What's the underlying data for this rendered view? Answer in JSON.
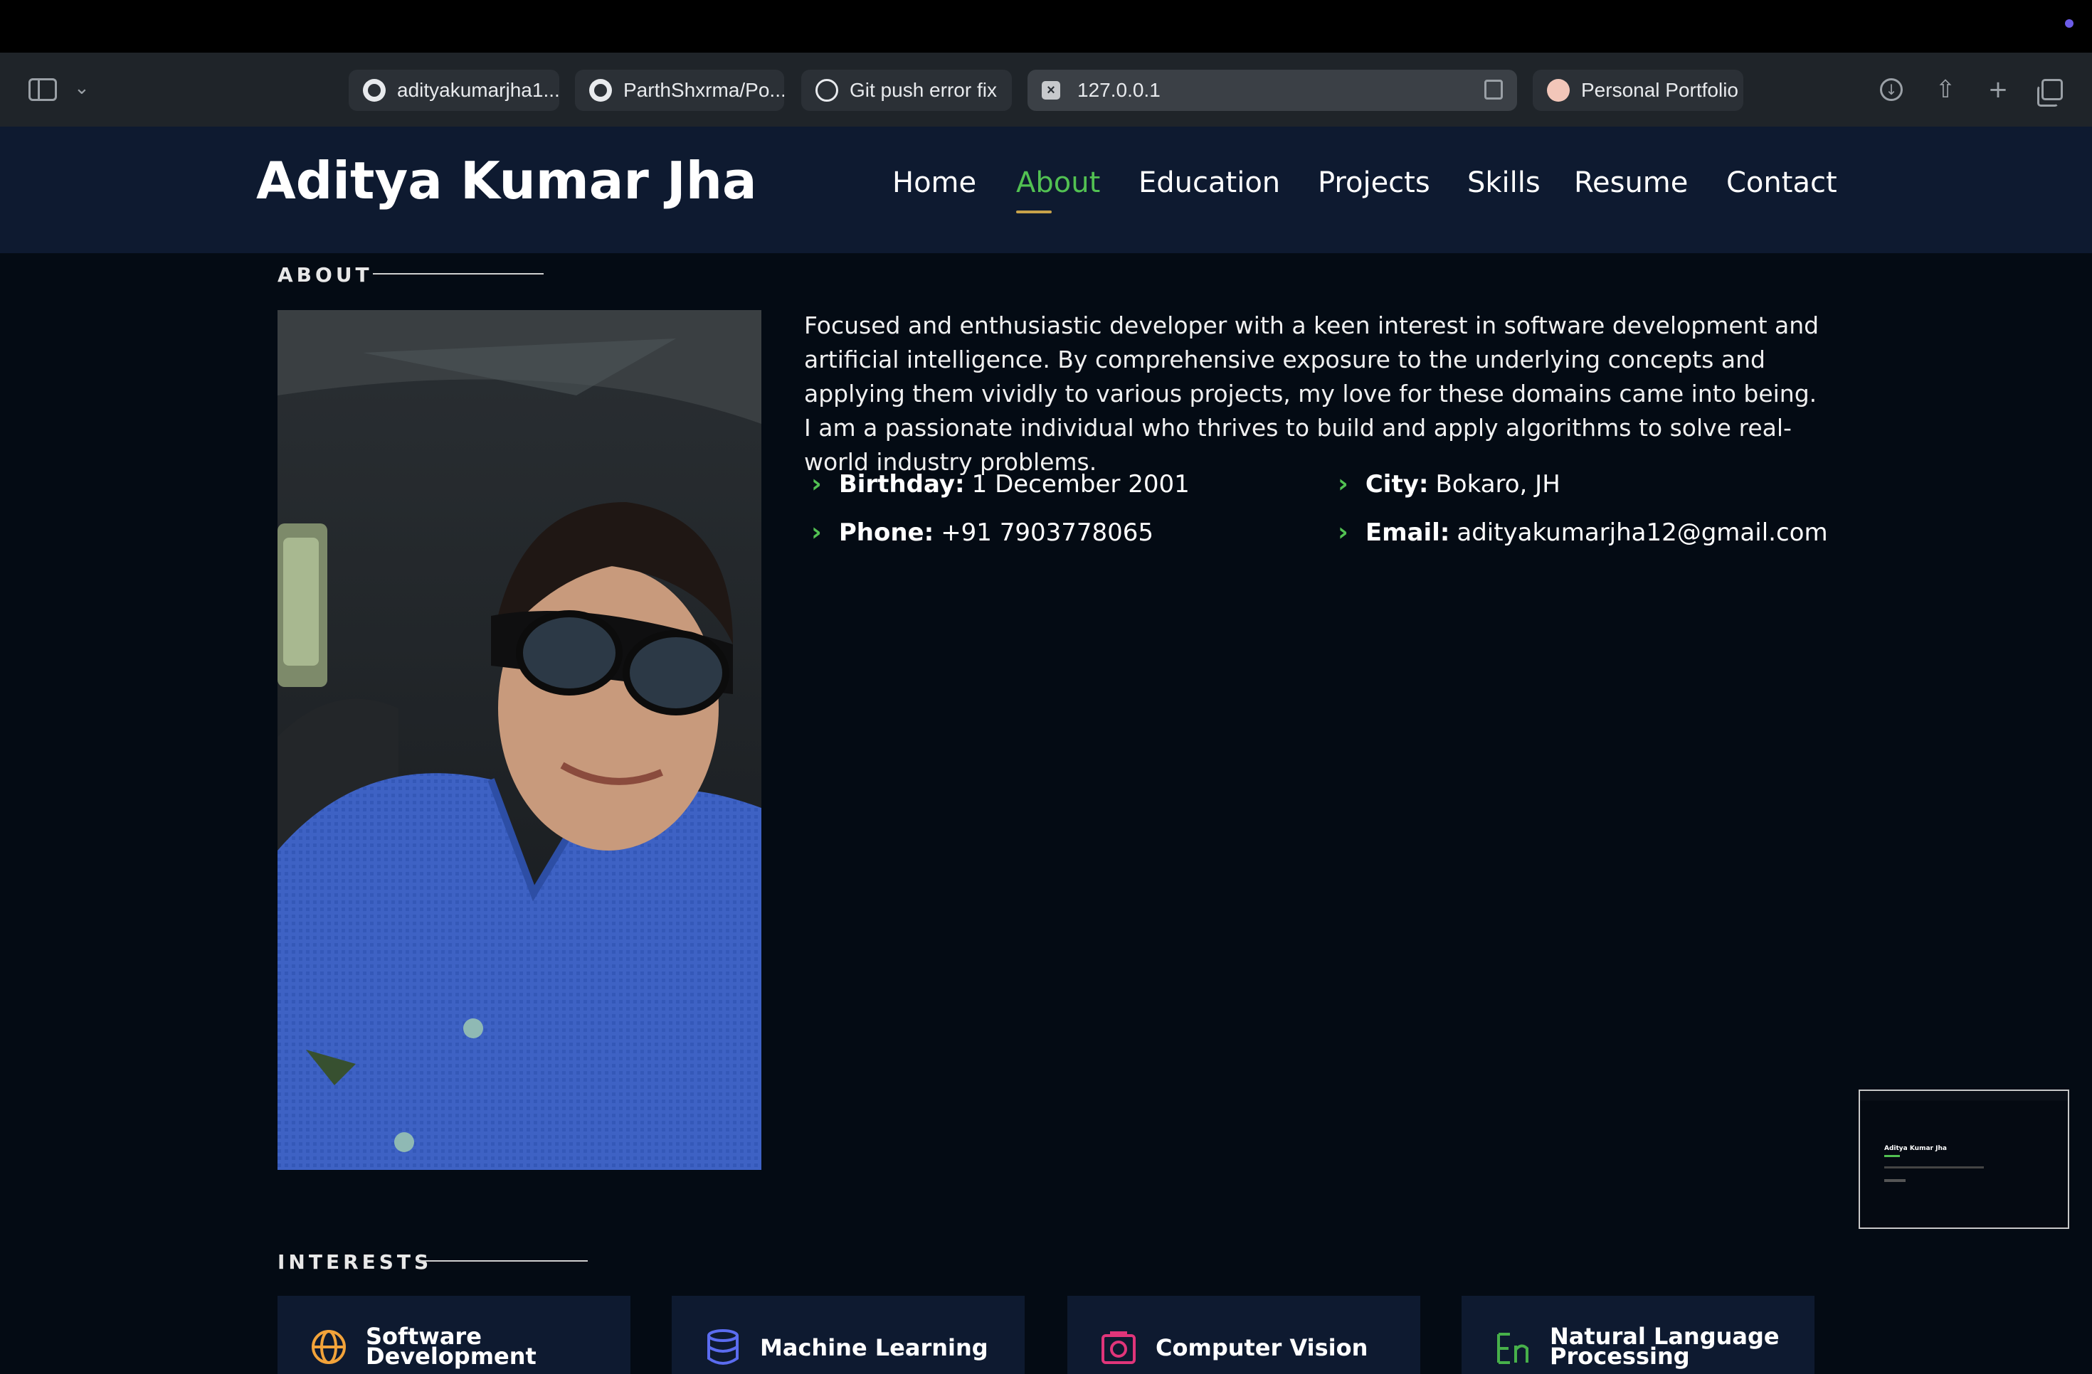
{
  "browser": {
    "tabs": [
      {
        "label": "adityakumarjha1...",
        "icon": "github-icon"
      },
      {
        "label": "ParthShxrma/Po...",
        "icon": "github-icon"
      },
      {
        "label": "Git push error fix",
        "icon": "chatgpt-icon"
      },
      {
        "label": "127.0.0.1",
        "icon": "close-tab-icon",
        "active": true
      },
      {
        "label": "Personal Portfolio",
        "icon": "portfolio-favicon-icon"
      }
    ]
  },
  "site": {
    "name": "Aditya Kumar Jha",
    "nav": [
      "Home",
      "About",
      "Education",
      "Projects",
      "Skills",
      "Resume",
      "Contact"
    ],
    "active_nav": "About",
    "accent_color": "#52c152"
  },
  "about": {
    "title": "ABOUT",
    "paragraph": "Focused and enthusiastic developer with a keen interest in software development and artificial intelligence. By comprehensive exposure to the underlying concepts and applying them vividly to various projects, my love for these domains came into being. I am a passionate individual who thrives to build and apply algorithms to solve real-world industry problems.",
    "details": {
      "birthday_label": "Birthday:",
      "birthday_value": "1 December 2001",
      "phone_label": "Phone:",
      "phone_value": "+91 7903778065",
      "city_label": "City:",
      "city_value": "Bokaro, JH",
      "email_label": "Email:",
      "email_value": "adityakumarjha12@gmail.com"
    }
  },
  "interests": {
    "title": "INTERESTS",
    "items": [
      {
        "line1": "Software",
        "line2": "Development",
        "icon": "globe-icon",
        "color": "#f2a33a"
      },
      {
        "line1": "Machine Learning",
        "line2": "",
        "icon": "database-icon",
        "color": "#5b6cf0"
      },
      {
        "line1": "Computer Vision",
        "line2": "",
        "icon": "camera-icon",
        "color": "#e0357a"
      },
      {
        "line1": "Natural Language",
        "line2": "Processing",
        "icon": "language-icon",
        "color": "#47b04a"
      }
    ]
  },
  "thumbnail": {
    "title": "Aditya Kumar Jha"
  }
}
